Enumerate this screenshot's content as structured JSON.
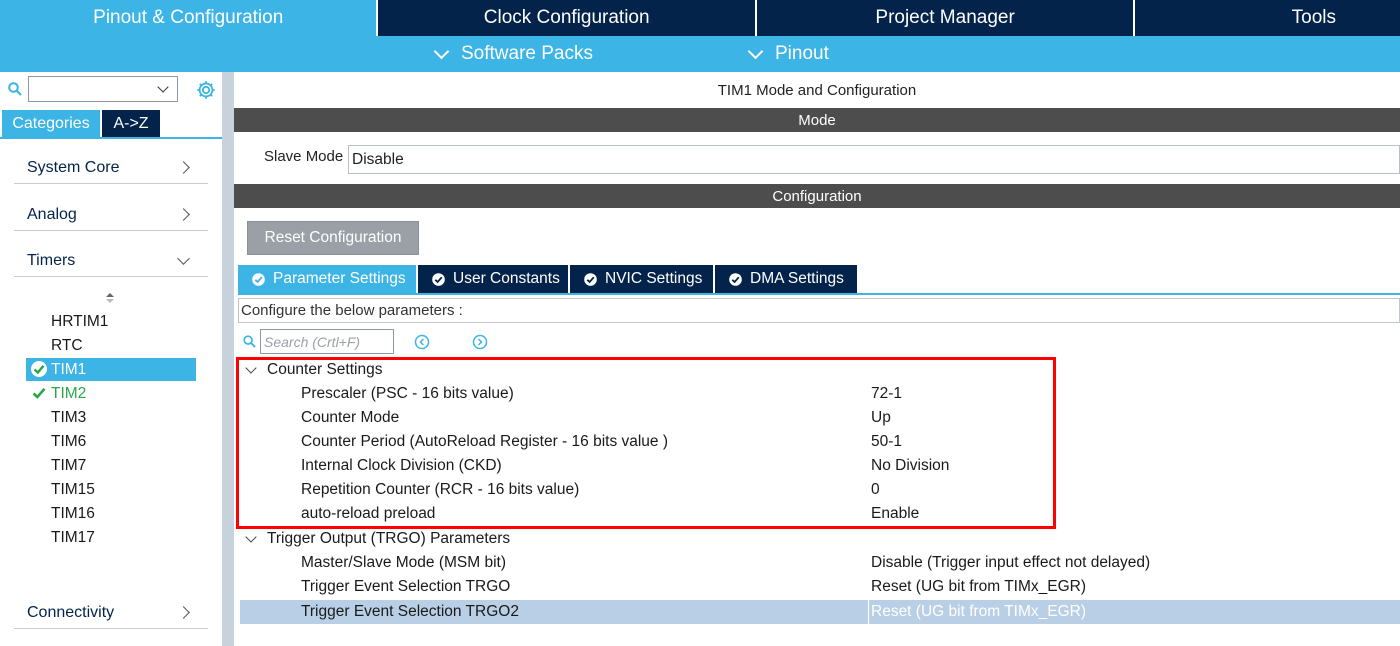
{
  "top_tabs": [
    {
      "label": "Pinout & Configuration",
      "active": true
    },
    {
      "label": "Clock Configuration"
    },
    {
      "label": "Project Manager"
    },
    {
      "label": "Tools"
    }
  ],
  "sub_menu": [
    "Software Packs",
    "Pinout"
  ],
  "left_panel": {
    "search_value": "",
    "category_tabs": [
      "Categories",
      "A->Z"
    ],
    "categories": [
      {
        "label": "System Core"
      },
      {
        "label": "Analog"
      },
      {
        "label": "Timers",
        "expanded": true
      },
      {
        "label": "Connectivity"
      }
    ],
    "timers": [
      "HRTIM1",
      "RTC",
      "TIM1",
      "TIM2",
      "TIM3",
      "TIM6",
      "TIM7",
      "TIM15",
      "TIM16",
      "TIM17"
    ],
    "selected_timer": "TIM1",
    "icons": {
      "search": "search-icon",
      "gear": "gear-icon",
      "sort": "sort-icon",
      "check": "check-icon"
    }
  },
  "main": {
    "title": "TIM1 Mode and Configuration",
    "mode_header": "Mode",
    "slave_mode_label": "Slave Mode",
    "slave_mode_value": "Disable",
    "config_header": "Configuration",
    "reset_button": "Reset Configuration",
    "param_tabs": [
      "Parameter Settings",
      "User Constants",
      "NVIC Settings",
      "DMA Settings"
    ],
    "configure_hint": "Configure the below parameters :",
    "search_placeholder": "Search (Crtl+F)",
    "groups": [
      {
        "name": "Counter Settings",
        "params": [
          {
            "name": "Prescaler (PSC - 16 bits value)",
            "value": "72-1"
          },
          {
            "name": "Counter Mode",
            "value": "Up"
          },
          {
            "name": "Counter Period (AutoReload Register - 16 bits value )",
            "value": "50-1"
          },
          {
            "name": "Internal Clock Division (CKD)",
            "value": "No Division"
          },
          {
            "name": "Repetition Counter (RCR - 16 bits value)",
            "value": "0"
          },
          {
            "name": "auto-reload preload",
            "value": "Enable"
          }
        ]
      },
      {
        "name": "Trigger Output (TRGO) Parameters",
        "params": [
          {
            "name": "Master/Slave Mode (MSM bit)",
            "value": "Disable (Trigger input effect not delayed)"
          },
          {
            "name": "Trigger Event Selection TRGO",
            "value": "Reset (UG bit from TIMx_EGR)"
          },
          {
            "name": "Trigger Event Selection TRGO2",
            "value": "Reset (UG bit from TIMx_EGR)"
          }
        ]
      }
    ]
  },
  "colors": {
    "accent": "#3cb4e6",
    "navy": "#03234b",
    "section": "#4d4d4d",
    "highlight": "#ff0000",
    "check_green": "#2aa64a"
  }
}
